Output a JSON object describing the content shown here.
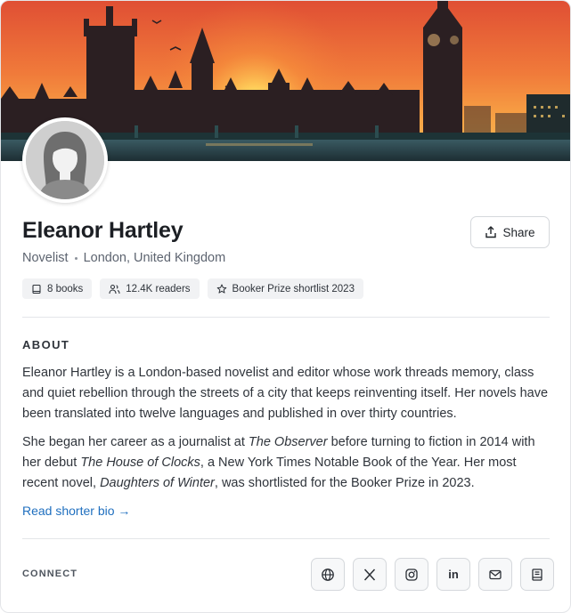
{
  "profile": {
    "name": "Eleanor Hartley",
    "occupation": "Novelist",
    "location": "London, United Kingdom"
  },
  "share_label": "Share",
  "badges": [
    {
      "icon": "book-icon",
      "label": "8 books"
    },
    {
      "icon": "readers-icon",
      "label": "12.4K readers"
    },
    {
      "icon": "star-icon",
      "label": "Booker Prize shortlist 2023"
    }
  ],
  "about": {
    "title": "ABOUT",
    "p1": "Eleanor Hartley is a London-based novelist and editor whose work threads memory, class and quiet rebellion through the streets of a city that keeps reinventing itself. Her novels have been translated into twelve languages and published in over thirty countries.",
    "p2_a": "She began her career as a journalist at ",
    "p2_b": "The Observer",
    "p2_c": " before turning to fiction in 2014 with her debut ",
    "p2_d": "The House of Clocks",
    "p2_e": ", a New York Times Notable Book of the Year. Her most recent novel, ",
    "p2_f": "Daughters of Winter",
    "p2_g": ", was shortlisted for the Booker Prize in 2023.",
    "toggle_link": "Read shorter bio →"
  },
  "connect": {
    "label": "CONNECT",
    "links": [
      "globe-icon",
      "x-icon",
      "instagram-icon",
      "linkedin-icon",
      "mail-icon",
      "book-icon"
    ],
    "linkedin_text": "in"
  },
  "colors": {
    "accent": "#1f6fbf",
    "sky_top": "#e8623a",
    "sky_glow": "#ffd35c"
  }
}
